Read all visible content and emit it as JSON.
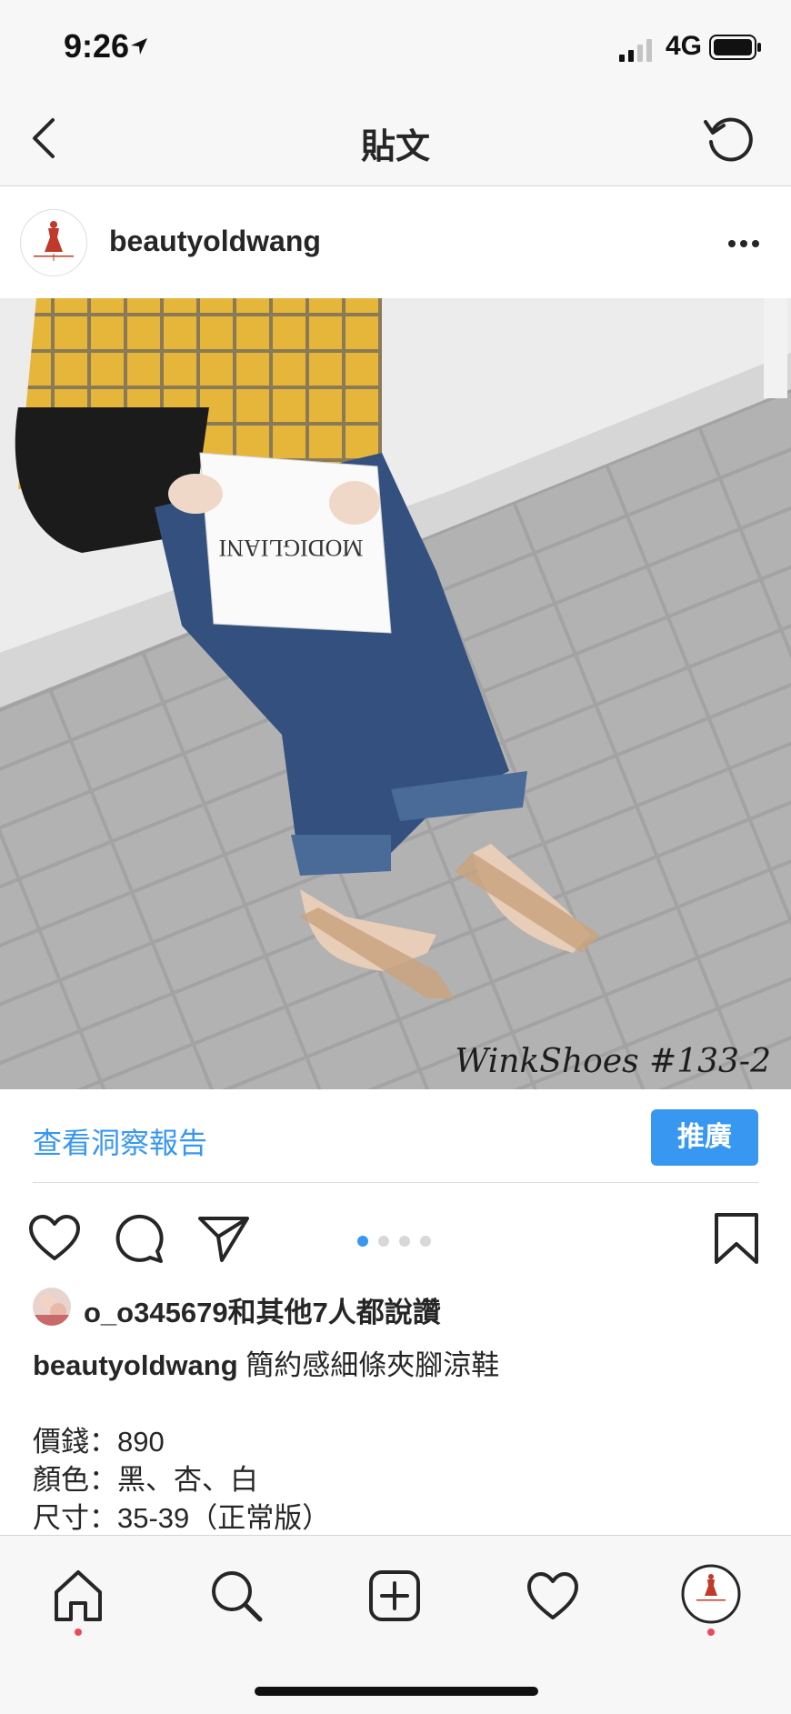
{
  "status_bar": {
    "time": "9:26",
    "network": "4G"
  },
  "nav": {
    "title": "貼文"
  },
  "post": {
    "username": "beautyoldwang",
    "avatar_logo_text": "BEAUTY OLDWANG",
    "photo": {
      "book_title": "MODIGLIANI",
      "watermark": "WinkShoes #133-2"
    },
    "insights_link": "查看洞察報告",
    "promote_label": "推廣",
    "carousel": {
      "count": 4,
      "active_index": 0
    },
    "likes_text": "o_o345679和其他7人都說讚",
    "caption_username": "beautyoldwang",
    "caption_text": "簡約感細條夾腳涼鞋",
    "details": [
      "價錢：890",
      "顏色：黑、杏、白",
      "尺寸：35-39（正常版）"
    ]
  },
  "colors": {
    "accent": "#3897f0",
    "notification_dot": "#ed4956",
    "text": "#262626",
    "bar_bg": "#f7f7f7"
  },
  "icons": [
    "back-chevron-icon",
    "refresh-icon",
    "more-options-icon",
    "heart-icon",
    "comment-icon",
    "share-icon",
    "bookmark-icon",
    "home-icon",
    "search-icon",
    "new-post-icon",
    "activity-icon",
    "profile-icon"
  ]
}
